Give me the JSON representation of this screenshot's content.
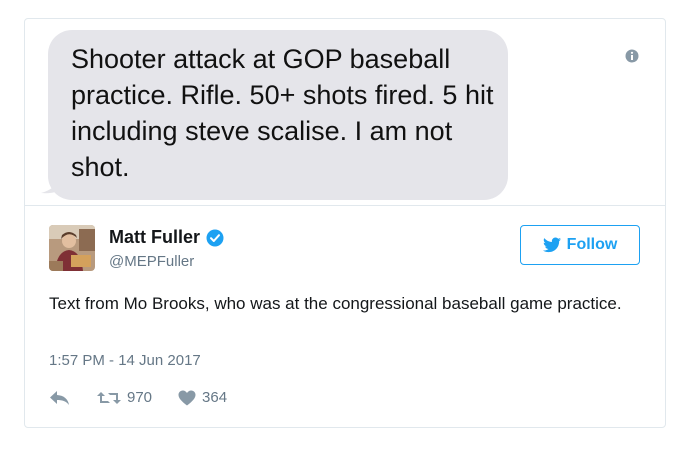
{
  "media": {
    "message_text": "Shooter attack at GOP baseball practice.  Rifle.  50+ shots fired.  5 hit including steve scalise.  I am not shot."
  },
  "author": {
    "name": "Matt Fuller",
    "handle": "@MEPFuller"
  },
  "follow_button": {
    "label": "Follow"
  },
  "tweet": {
    "text": "Text from Mo Brooks, who was at the congressional baseball game practice.",
    "timestamp": "1:57 PM - 14 Jun 2017",
    "retweets": "970",
    "likes": "364"
  },
  "icons": {
    "info": "info-icon",
    "verified": "verified-badge-icon",
    "bird": "twitter-bird-icon",
    "reply": "reply-icon",
    "retweet": "retweet-icon",
    "like": "heart-icon"
  },
  "colors": {
    "accent": "#1da1f2",
    "bubble": "#e5e5ea",
    "text": "#14171a",
    "muted": "#657786",
    "border": "#e1e8ed"
  }
}
